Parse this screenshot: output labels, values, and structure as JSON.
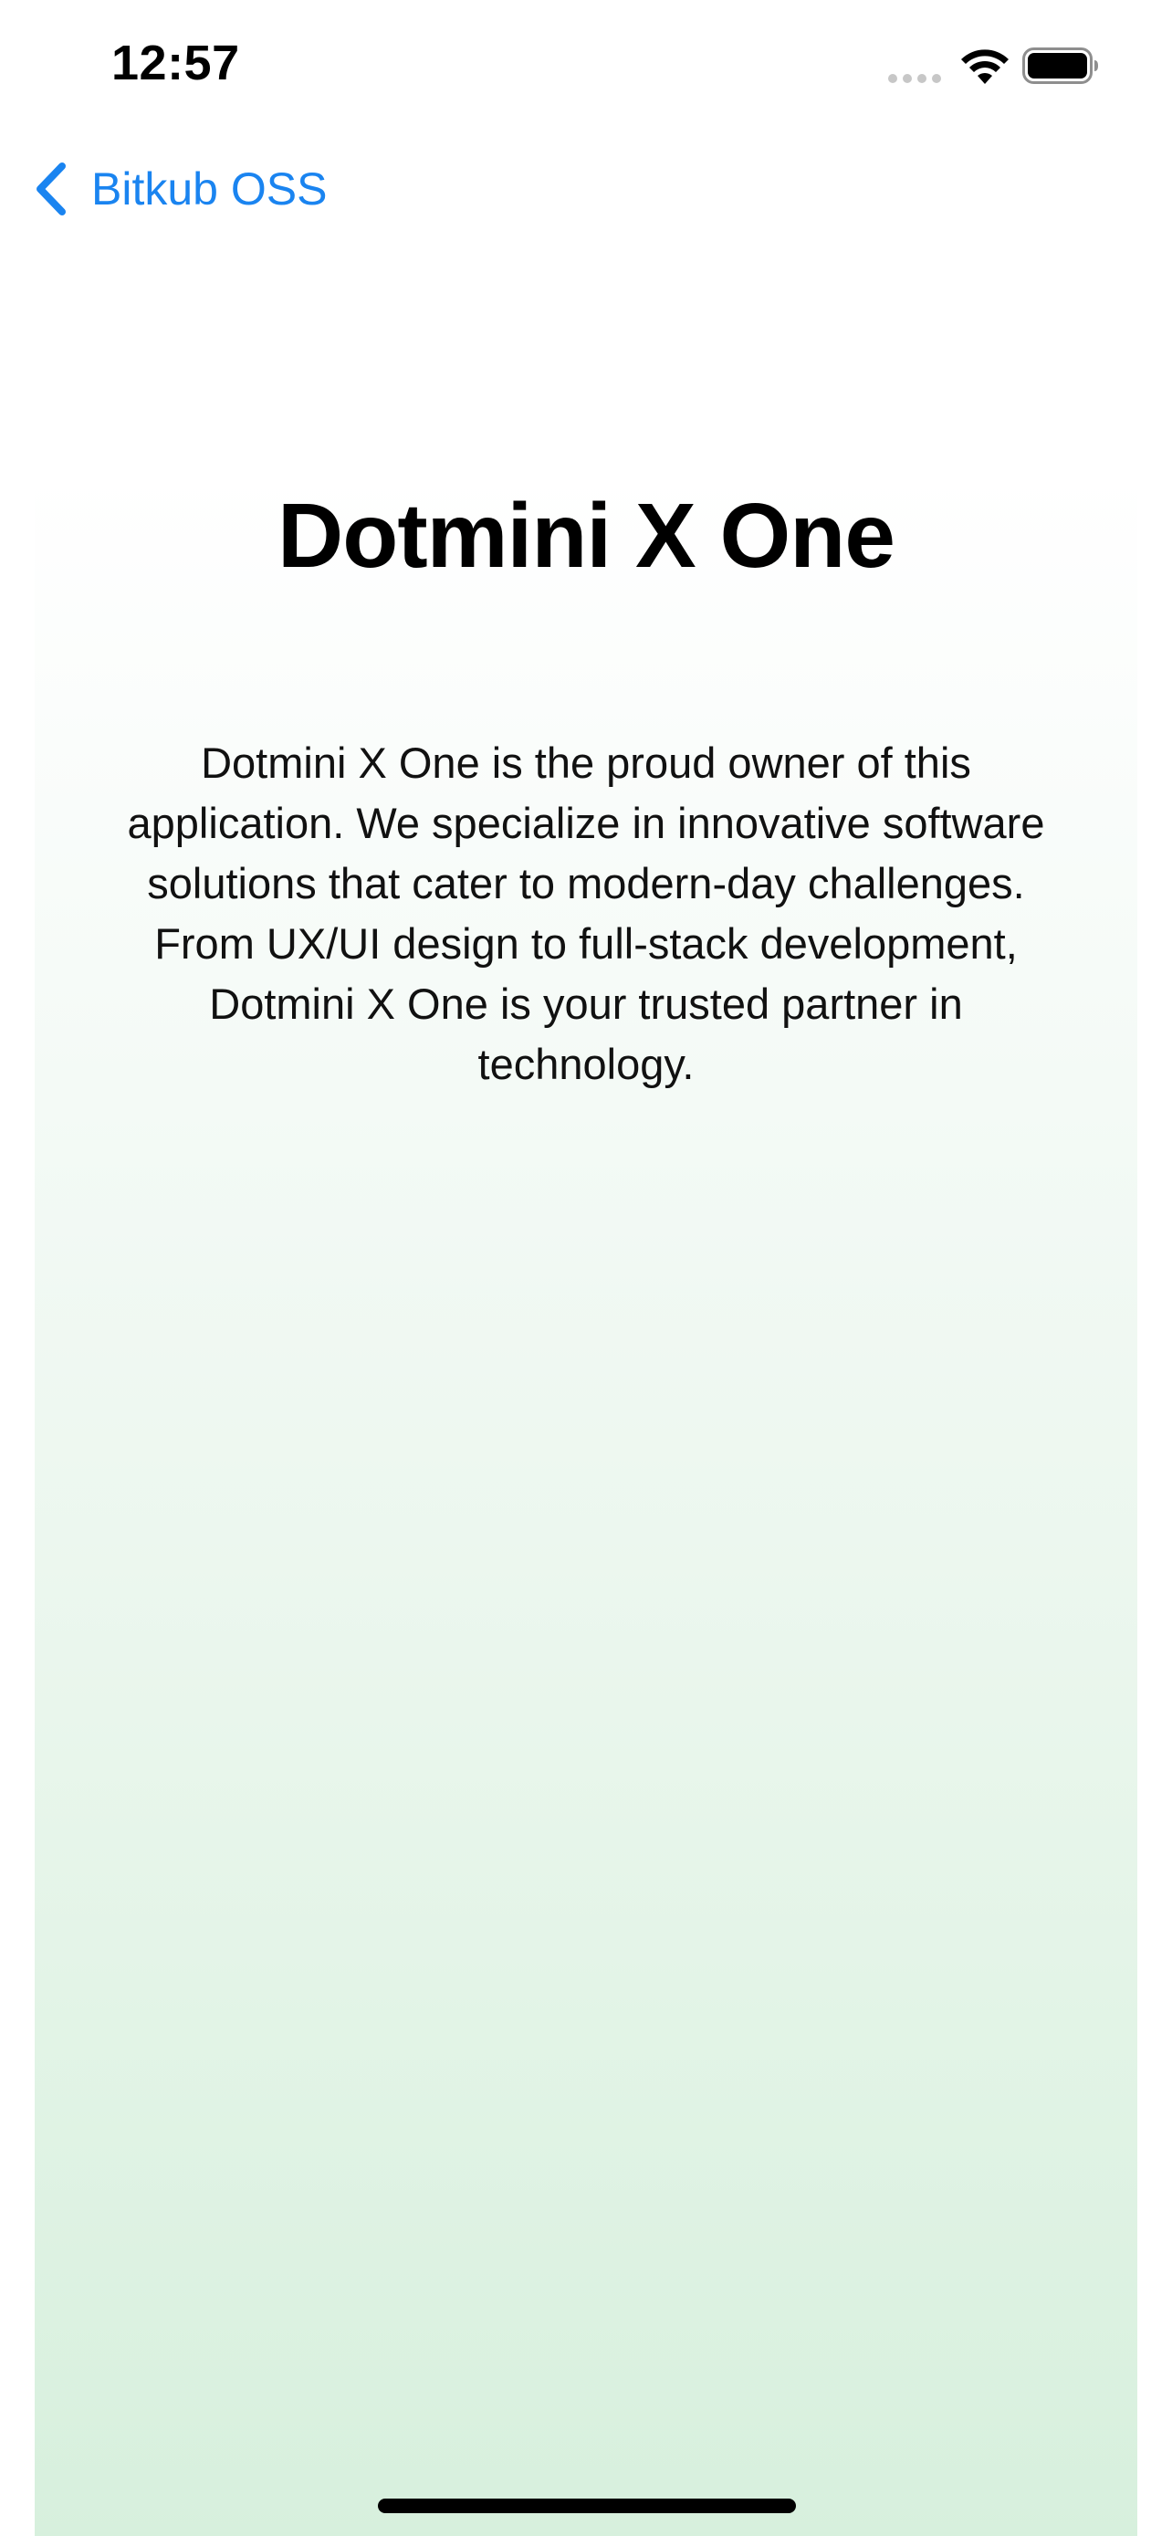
{
  "status_bar": {
    "time": "12:57"
  },
  "nav": {
    "back_label": "Bitkub OSS",
    "back_icon": "chevron-left-icon"
  },
  "content": {
    "title": "Dotmini X One",
    "description": "Dotmini X One is the proud owner of this application. We specialize in innovative software solutions that cater to modern-day challenges. From UX/UI design to full-stack development, Dotmini X One is your trusted partner in technology."
  },
  "colors": {
    "accent": "#1a84f0",
    "gradient_top": "#ffffff",
    "gradient_bottom": "#d7f0dd"
  }
}
